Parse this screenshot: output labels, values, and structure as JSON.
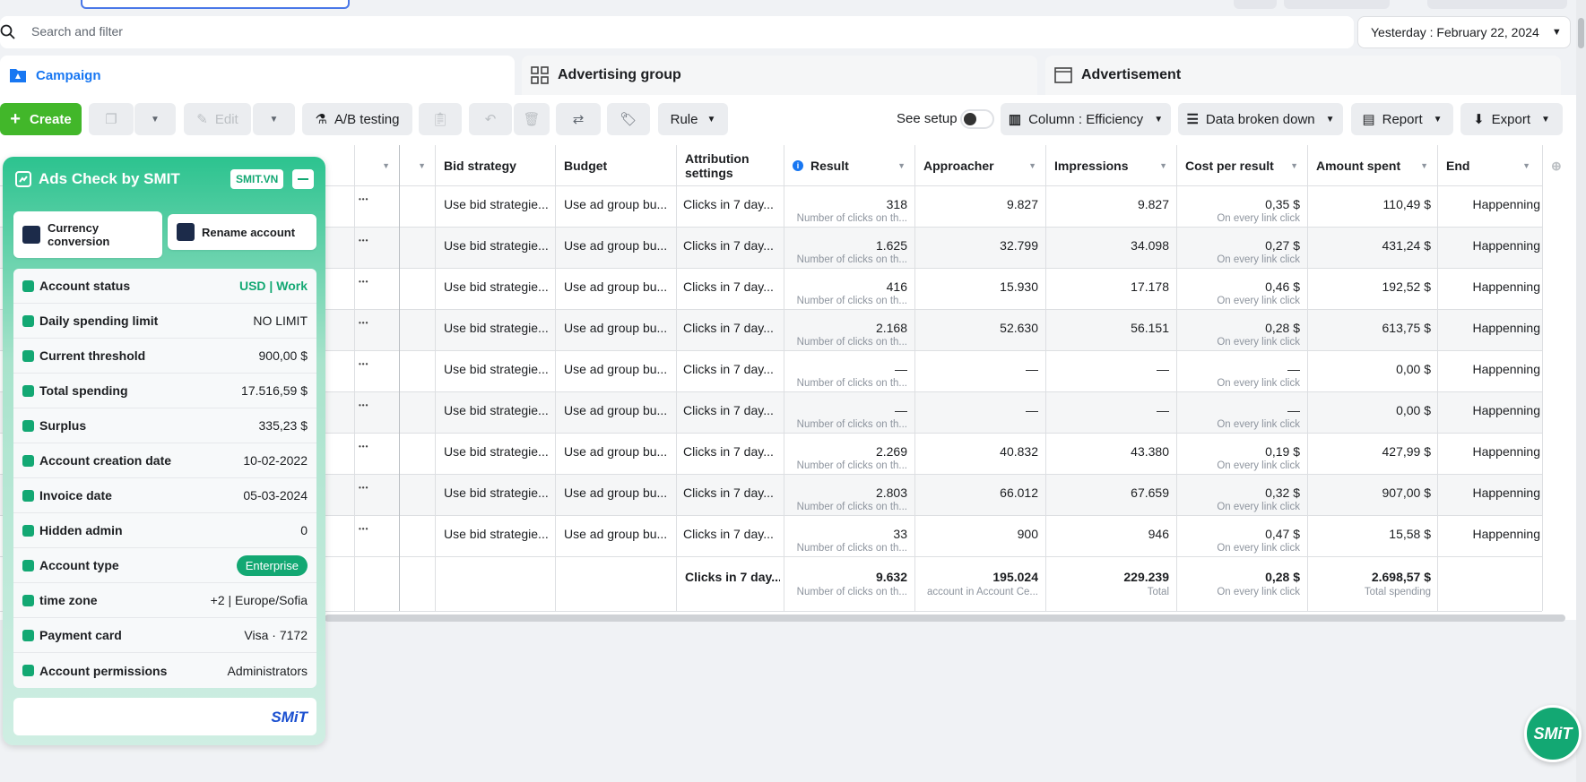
{
  "search": {
    "placeholder": "Search and filter"
  },
  "date_range": {
    "label": "Yesterday : February 22, 2024"
  },
  "tabs": {
    "campaign": "Campaign",
    "advertising_group": "Advertising group",
    "advertisement": "Advertisement"
  },
  "toolbar": {
    "create": "Create",
    "edit": "Edit",
    "ab_testing": "A/B testing",
    "rule": "Rule",
    "see_setup": "See setup",
    "column": "Column : Efficiency",
    "breakdown": "Data broken down",
    "report": "Report",
    "export": "Export"
  },
  "table": {
    "headers": {
      "bid_strategy": "Bid strategy",
      "budget": "Budget",
      "attribution": "Attribution settings",
      "result": "Result",
      "approacher": "Approacher",
      "impressions": "Impressions",
      "cost_per_result": "Cost per result",
      "amount_spent": "Amount spent",
      "end": "End"
    },
    "rows": [
      {
        "bid": "Use bid strategie...",
        "budget": "Use ad group bu...",
        "attr": "Clicks in 7 day...",
        "result": "318",
        "result_sub": "Number of clicks on th...",
        "approacher": "9.827",
        "impressions": "9.827",
        "cpr": "0,35 $",
        "cpr_sub": "On every link click",
        "spent": "110,49 $",
        "end": "Happenning"
      },
      {
        "bid": "Use bid strategie...",
        "budget": "Use ad group bu...",
        "attr": "Clicks in 7 day...",
        "result": "1.625",
        "result_sub": "Number of clicks on th...",
        "approacher": "32.799",
        "impressions": "34.098",
        "cpr": "0,27 $",
        "cpr_sub": "On every link click",
        "spent": "431,24 $",
        "end": "Happenning"
      },
      {
        "bid": "Use bid strategie...",
        "budget": "Use ad group bu...",
        "attr": "Clicks in 7 day...",
        "result": "416",
        "result_sub": "Number of clicks on th...",
        "approacher": "15.930",
        "impressions": "17.178",
        "cpr": "0,46 $",
        "cpr_sub": "On every link click",
        "spent": "192,52 $",
        "end": "Happenning"
      },
      {
        "bid": "Use bid strategie...",
        "budget": "Use ad group bu...",
        "attr": "Clicks in 7 day...",
        "result": "2.168",
        "result_sub": "Number of clicks on th...",
        "approacher": "52.630",
        "impressions": "56.151",
        "cpr": "0,28 $",
        "cpr_sub": "On every link click",
        "spent": "613,75 $",
        "end": "Happenning"
      },
      {
        "bid": "Use bid strategie...",
        "budget": "Use ad group bu...",
        "attr": "Clicks in 7 day...",
        "result": "—",
        "result_sub": "Number of clicks on th...",
        "approacher": "—",
        "impressions": "—",
        "cpr": "—",
        "cpr_sub": "On every link click",
        "spent": "0,00 $",
        "end": "Happenning"
      },
      {
        "bid": "Use bid strategie...",
        "budget": "Use ad group bu...",
        "attr": "Clicks in 7 day...",
        "result": "—",
        "result_sub": "Number of clicks on th...",
        "approacher": "—",
        "impressions": "—",
        "cpr": "—",
        "cpr_sub": "On every link click",
        "spent": "0,00 $",
        "end": "Happenning"
      },
      {
        "bid": "Use bid strategie...",
        "budget": "Use ad group bu...",
        "attr": "Clicks in 7 day...",
        "result": "2.269",
        "result_sub": "Number of clicks on th...",
        "approacher": "40.832",
        "impressions": "43.380",
        "cpr": "0,19 $",
        "cpr_sub": "On every link click",
        "spent": "427,99 $",
        "end": "Happenning"
      },
      {
        "bid": "Use bid strategie...",
        "budget": "Use ad group bu...",
        "attr": "Clicks in 7 day...",
        "result": "2.803",
        "result_sub": "Number of clicks on th...",
        "approacher": "66.012",
        "impressions": "67.659",
        "cpr": "0,32 $",
        "cpr_sub": "On every link click",
        "spent": "907,00 $",
        "end": "Happenning"
      },
      {
        "bid": "Use bid strategie...",
        "budget": "Use ad group bu...",
        "attr": "Clicks in 7 day...",
        "result": "33",
        "result_sub": "Number of clicks on th...",
        "approacher": "900",
        "impressions": "946",
        "cpr": "0,47 $",
        "cpr_sub": "On every link click",
        "spent": "15,58 $",
        "end": "Happenning"
      }
    ],
    "totals": {
      "attr": "Clicks in 7 day...",
      "result": "9.632",
      "result_sub": "Number of clicks on th...",
      "approacher": "195.024",
      "approacher_sub": "account in Account Ce...",
      "impressions": "229.239",
      "impressions_sub": "Total",
      "cpr": "0,28 $",
      "cpr_sub": "On every link click",
      "spent": "2.698,57 $",
      "spent_sub": "Total spending"
    }
  },
  "smit_panel": {
    "title": "Ads Check by SMIT",
    "badge": "SMIT.VN",
    "currency_btn": "Currency conversion",
    "rename_btn": "Rename account",
    "rows": [
      {
        "label": "Account status",
        "value": "USD | Work"
      },
      {
        "label": "Daily spending limit",
        "value": "NO LIMIT"
      },
      {
        "label": "Current threshold",
        "value": "900,00 $"
      },
      {
        "label": "Total spending",
        "value": "17.516,59 $"
      },
      {
        "label": "Surplus",
        "value": "335,23 $"
      },
      {
        "label": "Account creation date",
        "value": "10-02-2022"
      },
      {
        "label": "Invoice date",
        "value": "05-03-2024"
      },
      {
        "label": "Hidden admin",
        "value": "0"
      },
      {
        "label": "Account type",
        "value": "Enterprise"
      },
      {
        "label": "time zone",
        "value": "+2 | Europe/Sofia"
      },
      {
        "label": "Payment card",
        "value": "Visa · 7172"
      },
      {
        "label": "Account permissions",
        "value": "Administrators"
      }
    ],
    "footer_brand": "SMiT"
  },
  "fab": {
    "label": "SMiT"
  },
  "colors": {
    "accent": "#1877f2",
    "create": "#42b72a",
    "smit": "#13a873"
  }
}
